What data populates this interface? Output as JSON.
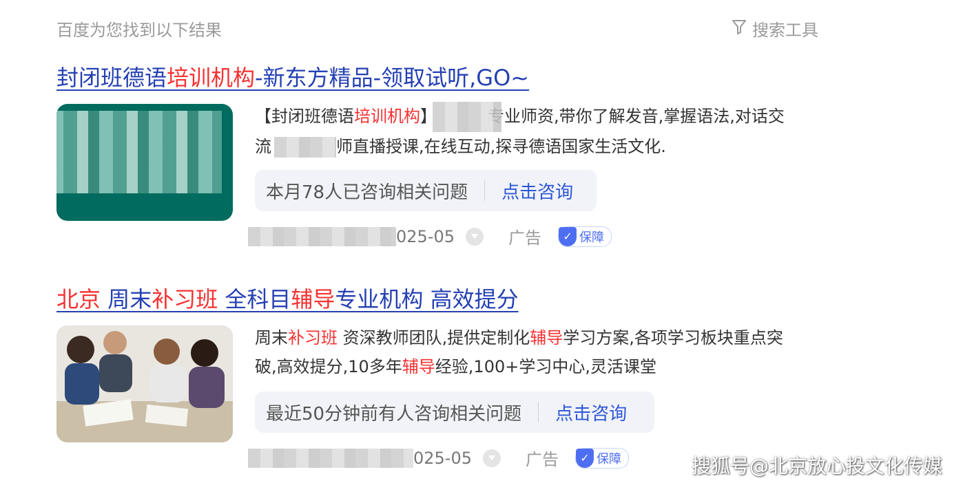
{
  "header": {
    "hint": "百度为您找到以下结果",
    "tools_label": "搜索工具"
  },
  "results": [
    {
      "title_parts": [
        "封闭班德语",
        "培训机构",
        "-新东方精品-领取试听,GO~"
      ],
      "desc_line1": [
        "【封闭班德语",
        "培训机构",
        "】",
        "专业师资,带你了解发音,掌握语法,对话交"
      ],
      "desc_line2": "流",
      "desc_line2b": "师直播授课,在线互动,探寻德语国家生活文化.",
      "consult_text": "本月78人已咨询相关问题",
      "consult_btn": "点击咨询",
      "date": "025-05",
      "ad_label": "广告",
      "badge_label": "保障"
    },
    {
      "title_parts": [
        "北京",
        " 周末",
        "补习班",
        " 全科目",
        "辅导",
        "专业机构 高效提分"
      ],
      "desc_line1": [
        "周末",
        "补习班",
        " 资深教师团队,提供定制化",
        "辅导",
        "学习方案,各项学习板块重点突"
      ],
      "desc_line2": [
        "破,高效提分,10多年",
        "辅导",
        "经验,100+学习中心,灵活课堂"
      ],
      "consult_text": "最近50分钟前有人咨询相关问题",
      "consult_btn": "点击咨询",
      "date": "025-05",
      "ad_label": "广告",
      "badge_label": "保障"
    }
  ],
  "watermark": "搜狐号@北京放心投文化传媒",
  "colors": {
    "link": "#2440b3",
    "highlight": "#f73131",
    "consult_btn": "#2d57d8",
    "thumb1": "#006b5e"
  }
}
